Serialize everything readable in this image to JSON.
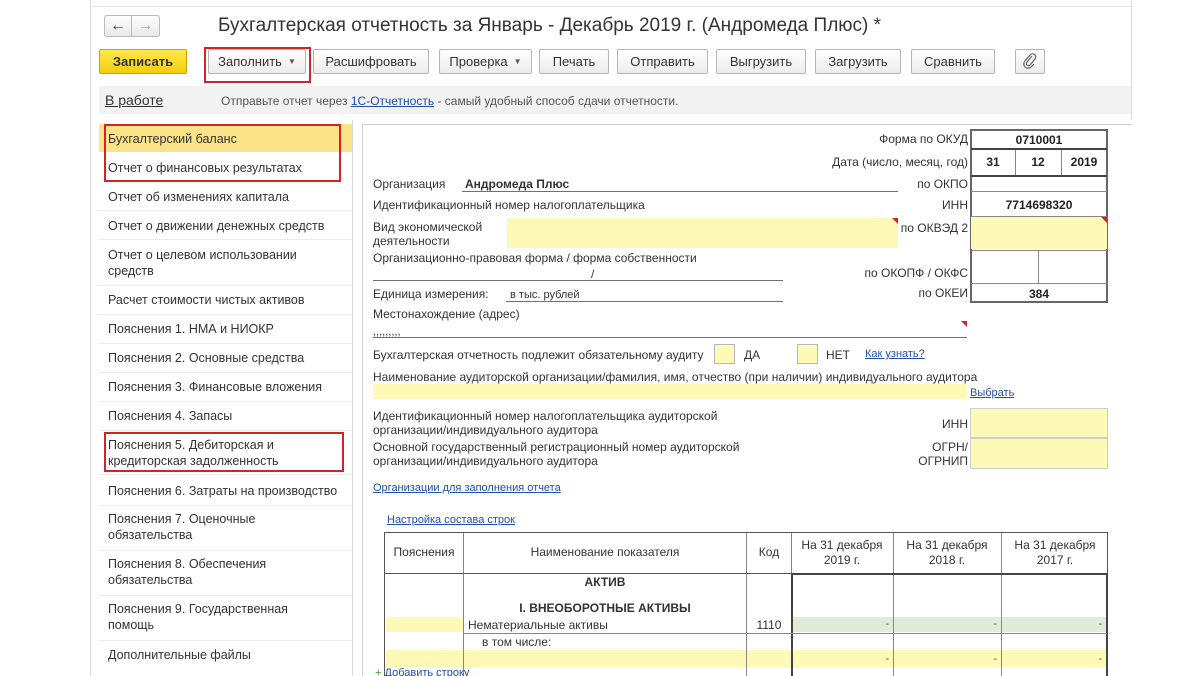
{
  "window": {
    "title": "Бухгалтерская отчетность за Январь - Декабрь 2019 г. (Андромеда Плюс) *",
    "back_icon": "arrow-left-icon",
    "forward_icon": "arrow-right-icon"
  },
  "toolbar": {
    "save_label": "Записать",
    "fill_label": "Заполнить",
    "decode_label": "Расшифровать",
    "check_label": "Проверка",
    "print_label": "Печать",
    "send_label": "Отправить",
    "unload_label": "Выгрузить",
    "load_label": "Загрузить",
    "compare_label": "Сравнить",
    "attach_icon": "paperclip-icon",
    "accent_color": "#f5cd0f"
  },
  "status": {
    "link": "В работе",
    "message_before": "Отправьте отчет через",
    "message_link": "1С-Отчетность",
    "message_after": "- самый удобный способ сдачи отчетности."
  },
  "sidebar": {
    "items": [
      {
        "label": "Бухгалтерский баланс"
      },
      {
        "label": "Отчет о финансовых результатах"
      },
      {
        "label": "Отчет об изменениях капитала"
      },
      {
        "label": "Отчет о движении денежных средств"
      },
      {
        "label": "Отчет о целевом использовании средств"
      },
      {
        "label": "Расчет стоимости чистых активов"
      },
      {
        "label": "Пояснения 1. НМА и НИОКР"
      },
      {
        "label": "Пояснения 2. Основные средства"
      },
      {
        "label": "Пояснения 3. Финансовые вложения"
      },
      {
        "label": "Пояснения 4. Запасы"
      },
      {
        "label": "Пояснения 5. Дебиторская и кредиторская задолженность"
      },
      {
        "label": "Пояснения 6. Затраты на производство"
      },
      {
        "label": "Пояснения 7. Оценочные обязательства"
      },
      {
        "label": "Пояснения 8. Обеспечения обязательства"
      },
      {
        "label": "Пояснения 9. Государственная помощь"
      },
      {
        "label": "Дополнительные файлы"
      }
    ],
    "selected_color": "#fbe487"
  },
  "form": {
    "okud_label": "Форма по ОКУД",
    "okud_value": "0710001",
    "date_label": "Дата (число, месяц, год)",
    "date_day": "31",
    "date_month": "12",
    "date_year": "2019",
    "org_label": "Организация",
    "org_value": "Андромеда Плюс",
    "okpo_label": "по ОКПО",
    "inn_caption": "Идентификационный номер налогоплательщика",
    "inn_label": "ИНН",
    "inn_value": "7714698320",
    "activity_label": "Вид экономической деятельности",
    "okved_label": "по ОКВЭД 2",
    "legal_form_label": "Организационно-правовая форма / форма собственности",
    "legal_form_sep": "/",
    "okopf_label": "по ОКОПФ / ОКФС",
    "unit_label": "Единица измерения:",
    "unit_value": "в тыс. рублей",
    "okei_label": "по ОКЕИ",
    "okei_value": "384",
    "address_label": "Местонахождение (адрес)",
    "address_value": ",,,,,,,,,",
    "audit_label": "Бухгалтерская отчетность подлежит обязательному аудиту",
    "audit_yes": "ДА",
    "audit_no": "НЕТ",
    "audit_help": "Как узнать?",
    "auditor_name_label": "Наименование аудиторской организации/фамилия, имя, отчество (при наличии) индивидуального аудитора",
    "choose_link": "Выбрать",
    "auditor_inn_label": "Идентификационный номер налогоплательщика аудиторской организации/индивидуального аудитора",
    "auditor_inn_short": "ИНН",
    "auditor_ogrn_label": "Основной государственный регистрационный номер аудиторской организации/индивидуального аудитора",
    "auditor_ogrn_short": "ОГРН/ ОГРНИП",
    "orgs_link": "Организации для заполнения отчета",
    "rows_link": "Настройка состава строк",
    "add_row_link": "Добавить строку"
  },
  "table": {
    "headers": [
      "Пояснения",
      "Наименование показателя",
      "Код",
      "На 31 декабря 2019 г.",
      "На 31 декабря 2018 г.",
      "На 31 декабря 2017 г."
    ],
    "section_title": "АКТИВ",
    "subsection_title": "I. ВНЕОБОРОТНЫЕ АКТИВЫ",
    "rows": [
      {
        "name": "Нематериальные активы",
        "code": "1110",
        "v2019": "-",
        "v2018": "-",
        "v2017": "-"
      },
      {
        "name": "в том числе:",
        "code": "",
        "v2019": "-",
        "v2018": "-",
        "v2017": "-"
      }
    ]
  }
}
